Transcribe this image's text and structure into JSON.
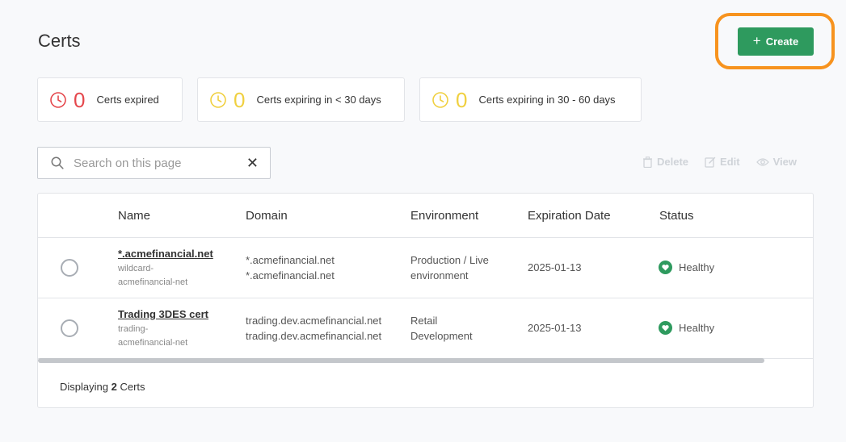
{
  "page": {
    "title": "Certs"
  },
  "toolbar": {
    "create_label": "Create",
    "highlight_color": "#f7931e",
    "create_color": "#2e9a5e"
  },
  "stats": [
    {
      "count": "0",
      "label": "Certs expired",
      "color": "#e5484d",
      "icon": "clock-icon"
    },
    {
      "count": "0",
      "label": "Certs expiring in < 30 days",
      "color": "#f0d040",
      "icon": "clock-icon"
    },
    {
      "count": "0",
      "label": "Certs expiring in 30 - 60 days",
      "color": "#f0d040",
      "icon": "clock-icon"
    }
  ],
  "search": {
    "placeholder": "Search on this page",
    "value": ""
  },
  "actions": {
    "delete": "Delete",
    "edit": "Edit",
    "view": "View"
  },
  "table": {
    "columns": [
      "Name",
      "Domain",
      "Environment",
      "Expiration Date",
      "Status"
    ],
    "rows": [
      {
        "name": "*.acmefinancial.net",
        "sub1": "wildcard-",
        "sub2": "acmefinancial-net",
        "domain1": "*.acmefinancial.net",
        "domain2": "*.acmefinancial.net",
        "env1": "Production / Live",
        "env2": "environment",
        "expiration": "2025-01-13",
        "status": "Healthy"
      },
      {
        "name": "Trading 3DES cert",
        "sub1": "trading-",
        "sub2": "acmefinancial-net",
        "domain1": "trading.dev.acmefinancial.net",
        "domain2": "trading.dev.acmefinancial.net",
        "env1": "Retail",
        "env2": "Development",
        "expiration": "2025-01-13",
        "status": "Healthy"
      }
    ]
  },
  "footer": {
    "prefix": "Displaying",
    "count": "2",
    "suffix": "Certs"
  }
}
